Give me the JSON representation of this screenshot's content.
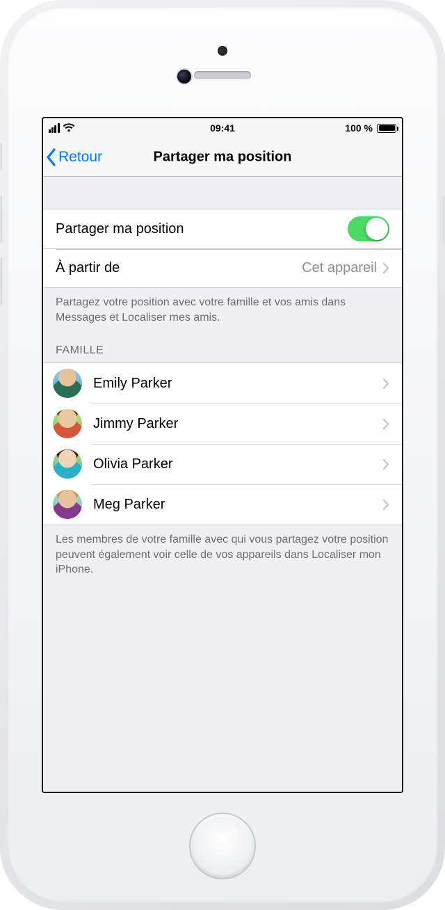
{
  "status_bar": {
    "time": "09:41",
    "battery_text": "100 %"
  },
  "nav": {
    "back_label": "Retour",
    "title": "Partager ma position"
  },
  "share": {
    "row_label": "Partager ma position",
    "toggle_on": true,
    "from_label": "À partir de",
    "from_value": "Cet appareil",
    "footer": "Partagez votre position avec votre famille et vos amis dans Messages et Localiser mes amis."
  },
  "family": {
    "header": "FAMILLE",
    "members": [
      {
        "name": "Emily Parker"
      },
      {
        "name": "Jimmy Parker"
      },
      {
        "name": "Olivia Parker"
      },
      {
        "name": "Meg Parker"
      }
    ],
    "footer": "Les membres de votre famille avec qui vous partagez votre position peuvent également voir celle de vos appareils dans Localiser mon iPhone."
  },
  "colors": {
    "tint": "#007aff",
    "toggle_on": "#4cd964"
  }
}
